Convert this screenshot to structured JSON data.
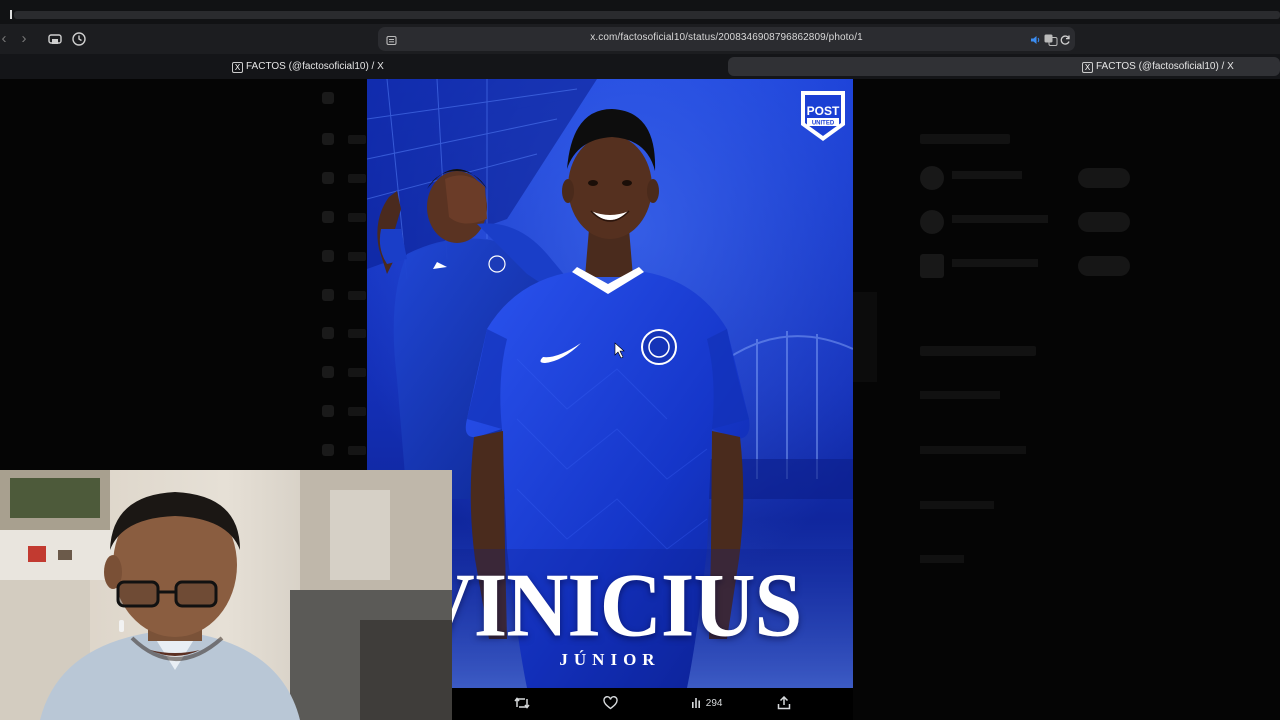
{
  "browser": {
    "url": "x.com/factosoficial10/status/2008346908796862809/photo/1",
    "tabs": [
      {
        "title": "FACTOS (@factosoficial10) / X",
        "active": false
      },
      {
        "title": "FACTOS (@factosoficial10) / X",
        "active": true
      }
    ]
  },
  "poster": {
    "headline": "VINICIUS",
    "subheadline": "JÚNIOR",
    "logo_text": [
      "POST",
      "UNITED"
    ]
  },
  "actions": {
    "views": "294",
    "icons": [
      "retweet-icon",
      "like-icon",
      "views-icon",
      "share-icon"
    ]
  },
  "colors": {
    "poster_blue": "#1233c8",
    "toolbar": "#1c1d20",
    "urlbar": "#2b2c30"
  }
}
